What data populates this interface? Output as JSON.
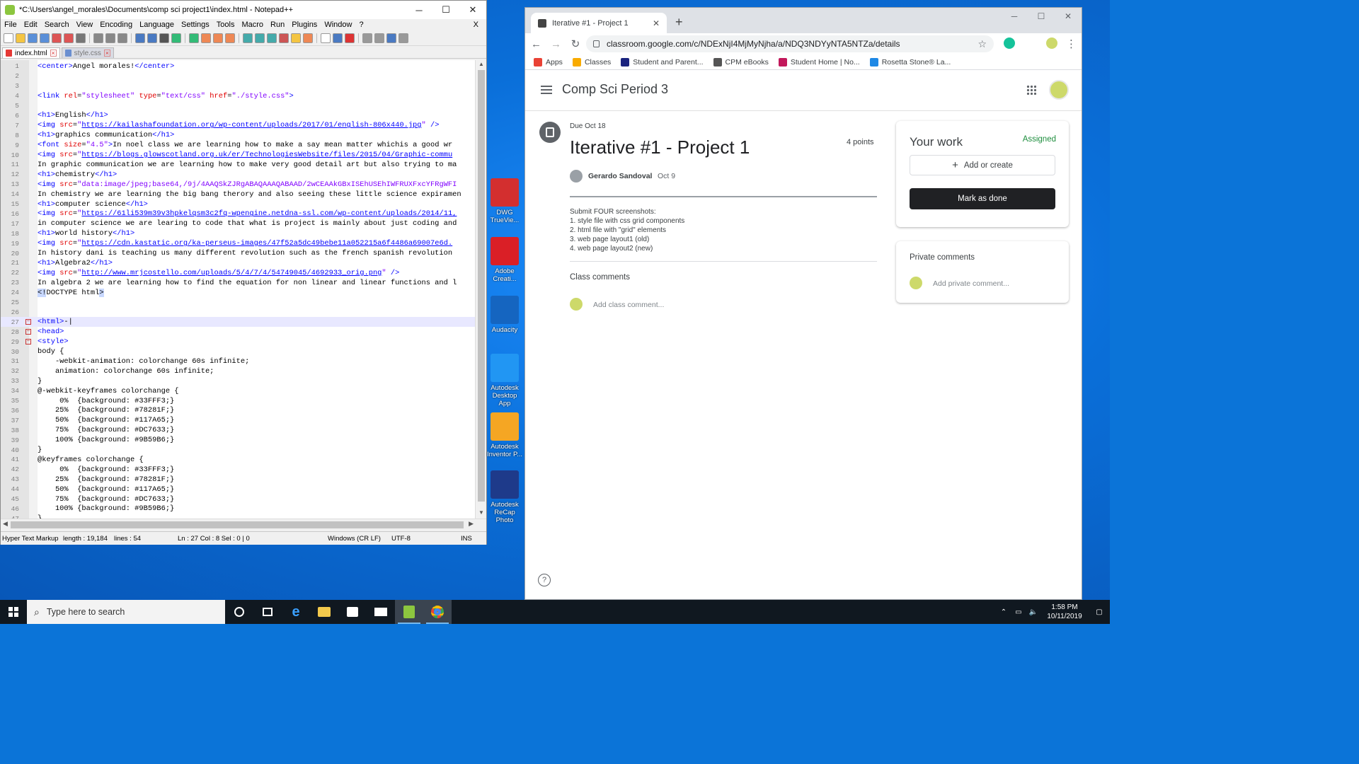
{
  "notepad": {
    "title": "*C:\\Users\\angel_morales\\Documents\\comp sci project1\\index.html - Notepad++",
    "menu": [
      "File",
      "Edit",
      "Search",
      "View",
      "Encoding",
      "Language",
      "Settings",
      "Tools",
      "Macro",
      "Run",
      "Plugins",
      "Window",
      "?"
    ],
    "menu_close": "X",
    "tabs": [
      "index.html",
      "style.css"
    ],
    "lines": [
      {
        "n": "1",
        "parts": [
          [
            "tag",
            "<center>"
          ],
          [
            "plain",
            "Angel morales!"
          ],
          [
            "tag",
            "</center>"
          ]
        ]
      },
      {
        "n": "2",
        "parts": []
      },
      {
        "n": "3",
        "parts": []
      },
      {
        "n": "4",
        "parts": [
          [
            "tag",
            "<link "
          ],
          [
            "attr",
            "rel"
          ],
          [
            "plain",
            "="
          ],
          [
            "val",
            "\"stylesheet\""
          ],
          [
            "plain",
            " "
          ],
          [
            "attr",
            "type"
          ],
          [
            "plain",
            "="
          ],
          [
            "val",
            "\"text/css\""
          ],
          [
            "plain",
            " "
          ],
          [
            "attr",
            "href"
          ],
          [
            "plain",
            "="
          ],
          [
            "val",
            "\"./style.css\""
          ],
          [
            "tag",
            ">"
          ]
        ]
      },
      {
        "n": "5",
        "parts": []
      },
      {
        "n": "6",
        "parts": [
          [
            "tag",
            "<h1>"
          ],
          [
            "plain",
            "English"
          ],
          [
            "tag",
            "</h1>"
          ]
        ]
      },
      {
        "n": "7",
        "parts": [
          [
            "tag",
            "<img "
          ],
          [
            "attr",
            "src"
          ],
          [
            "plain",
            "="
          ],
          [
            "val",
            "\""
          ],
          [
            "url",
            "https://kailashafoundation.org/wp-content/uploads/2017/01/english-806x440.jpg"
          ],
          [
            "val",
            "\""
          ],
          [
            "tag",
            " />"
          ]
        ]
      },
      {
        "n": "8",
        "parts": [
          [
            "tag",
            "<h1>"
          ],
          [
            "plain",
            "graphics communication"
          ],
          [
            "tag",
            "</h1>"
          ]
        ]
      },
      {
        "n": "9",
        "parts": [
          [
            "tag",
            "<font "
          ],
          [
            "attr",
            "size"
          ],
          [
            "plain",
            "="
          ],
          [
            "val",
            "\"4.5\""
          ],
          [
            "tag",
            ">"
          ],
          [
            "plain",
            "In noel class we are learning how to make a say mean matter whichis a good wr"
          ]
        ]
      },
      {
        "n": "10",
        "parts": [
          [
            "tag",
            "<img "
          ],
          [
            "attr",
            "src"
          ],
          [
            "plain",
            "="
          ],
          [
            "val",
            "\""
          ],
          [
            "url",
            "https://blogs.glowscotland.org.uk/er/TechnologiesWebsite/files/2015/04/Graphic-commu"
          ]
        ]
      },
      {
        "n": "11",
        "parts": [
          [
            "plain",
            "In graphic communication we are learning how to make very good detail art but also trying to ma"
          ]
        ]
      },
      {
        "n": "12",
        "parts": [
          [
            "tag",
            "<h1>"
          ],
          [
            "plain",
            "chemistry"
          ],
          [
            "tag",
            "</h1>"
          ]
        ]
      },
      {
        "n": "13",
        "parts": [
          [
            "tag",
            "<img "
          ],
          [
            "attr",
            "src"
          ],
          [
            "plain",
            "="
          ],
          [
            "val",
            "\"data:image/jpeg;base64,/9j/4AAQSkZJRgABAQAAAQABAAD/2wCEAAkGBxISEhUSEhIWFRUXFxcYFRgWFI"
          ]
        ]
      },
      {
        "n": "14",
        "parts": [
          [
            "plain",
            "In chemistry we are learning the big bang therory and also seeing these little science expiramen"
          ]
        ]
      },
      {
        "n": "15",
        "parts": [
          [
            "tag",
            "<h1>"
          ],
          [
            "plain",
            "computer science"
          ],
          [
            "tag",
            "</h1>"
          ]
        ]
      },
      {
        "n": "16",
        "parts": [
          [
            "tag",
            "<img "
          ],
          [
            "attr",
            "src"
          ],
          [
            "plain",
            "="
          ],
          [
            "val",
            "\""
          ],
          [
            "url",
            "https://61li539m39v3hpkelqsm3c2fq-wpengine.netdna-ssl.com/wp-content/uploads/2014/11,"
          ]
        ]
      },
      {
        "n": "17",
        "parts": [
          [
            "plain",
            "in computer science we are learing to code that what is project is mainly about just coding and"
          ]
        ]
      },
      {
        "n": "18",
        "parts": [
          [
            "tag",
            "<h1>"
          ],
          [
            "plain",
            "world history"
          ],
          [
            "tag",
            "</h1>"
          ]
        ]
      },
      {
        "n": "19",
        "parts": [
          [
            "tag",
            "<img "
          ],
          [
            "attr",
            "src"
          ],
          [
            "plain",
            "="
          ],
          [
            "val",
            "\""
          ],
          [
            "url",
            "https://cdn.kastatic.org/ka-perseus-images/47f52a5dc49bebe11a052215a6f4486a69007e6d."
          ]
        ]
      },
      {
        "n": "20",
        "parts": [
          [
            "plain",
            "In history dani is teaching us many different revolution such as the french spanish revolution"
          ]
        ]
      },
      {
        "n": "21",
        "parts": [
          [
            "tag",
            "<h1>"
          ],
          [
            "plain",
            "Algebra2"
          ],
          [
            "tag",
            "</h1>"
          ]
        ]
      },
      {
        "n": "22",
        "parts": [
          [
            "tag",
            "<img "
          ],
          [
            "attr",
            "src"
          ],
          [
            "plain",
            "="
          ],
          [
            "val",
            "\""
          ],
          [
            "url",
            "http://www.mrjcostello.com/uploads/5/4/7/4/54749045/4692933_orig.png"
          ],
          [
            "val",
            "\""
          ],
          [
            "tag",
            " />"
          ]
        ]
      },
      {
        "n": "23",
        "parts": [
          [
            "plain",
            "In algebra 2 we are learning how to find the equation for non linear and linear functions and l"
          ]
        ]
      },
      {
        "n": "24",
        "parts": [
          [
            "bracehl",
            "<!"
          ],
          [
            "plain",
            "DOCTYPE html"
          ],
          [
            "bracehl",
            ">"
          ]
        ]
      },
      {
        "n": "25",
        "parts": []
      },
      {
        "n": "26",
        "parts": []
      },
      {
        "n": "27",
        "fold": "−",
        "current": true,
        "parts": [
          [
            "tag",
            "<html>"
          ],
          [
            "plain",
            "-|"
          ]
        ]
      },
      {
        "n": "28",
        "fold": "−",
        "parts": [
          [
            "tag",
            "<head>"
          ]
        ]
      },
      {
        "n": "29",
        "fold": "−",
        "parts": [
          [
            "tag",
            "<style>"
          ]
        ]
      },
      {
        "n": "30",
        "parts": [
          [
            "plain",
            "body {"
          ]
        ]
      },
      {
        "n": "31",
        "parts": [
          [
            "plain",
            "    -webkit-animation: colorchange 60s infinite;"
          ]
        ]
      },
      {
        "n": "32",
        "parts": [
          [
            "plain",
            "    animation: colorchange 60s infinite;"
          ]
        ]
      },
      {
        "n": "33",
        "parts": [
          [
            "plain",
            "}"
          ]
        ]
      },
      {
        "n": "34",
        "parts": [
          [
            "plain",
            "@-webkit-keyframes colorchange {"
          ]
        ]
      },
      {
        "n": "35",
        "parts": [
          [
            "plain",
            "     0%  {background: #33FFF3;}"
          ]
        ]
      },
      {
        "n": "36",
        "parts": [
          [
            "plain",
            "    25%  {background: #78281F;}"
          ]
        ]
      },
      {
        "n": "37",
        "parts": [
          [
            "plain",
            "    50%  {background: #117A65;}"
          ]
        ]
      },
      {
        "n": "38",
        "parts": [
          [
            "plain",
            "    75%  {background: #DC7633;}"
          ]
        ]
      },
      {
        "n": "39",
        "parts": [
          [
            "plain",
            "    100% {background: #9B59B6;}"
          ]
        ]
      },
      {
        "n": "40",
        "parts": [
          [
            "plain",
            "}"
          ]
        ]
      },
      {
        "n": "41",
        "parts": [
          [
            "plain",
            "@keyframes colorchange {"
          ]
        ]
      },
      {
        "n": "42",
        "parts": [
          [
            "plain",
            "     0%  {background: #33FFF3;}"
          ]
        ]
      },
      {
        "n": "43",
        "parts": [
          [
            "plain",
            "    25%  {background: #78281F;}"
          ]
        ]
      },
      {
        "n": "44",
        "parts": [
          [
            "plain",
            "    50%  {background: #117A65;}"
          ]
        ]
      },
      {
        "n": "45",
        "parts": [
          [
            "plain",
            "    75%  {background: #DC7633;}"
          ]
        ]
      },
      {
        "n": "46",
        "parts": [
          [
            "plain",
            "    100% {background: #9B59B6;}"
          ]
        ]
      },
      {
        "n": "47",
        "parts": [
          [
            "plain",
            "}"
          ]
        ]
      }
    ],
    "status": {
      "lang": "Hyper Text Markup",
      "length": "length : 19,184",
      "lines": "lines : 54",
      "pos": "Ln : 27    Col : 8    Sel : 0 | 0",
      "eol": "Windows (CR LF)",
      "enc": "UTF-8",
      "mode": "INS"
    }
  },
  "desktop_icons": [
    {
      "label": "DWG TrueVie...",
      "color": "#d32f2f"
    },
    {
      "label": "Adobe Creati...",
      "color": "#da1f26"
    },
    {
      "label": "Audacity",
      "color": "#1565c0"
    },
    {
      "label": "Autodesk Desktop App",
      "color": "#2196f3"
    },
    {
      "label": "Autodesk Inventor P...",
      "color": "#f5a623"
    },
    {
      "label": "Autodesk ReCap Photo",
      "color": "#1e3a8a"
    }
  ],
  "chrome": {
    "tab_title": "Iterative #1 - Project 1",
    "url": "classroom.google.com/c/NDExNjI4MjMyNjha/a/NDQ3NDYyNTA5NTZa/details",
    "bookmarks": [
      {
        "label": "Apps",
        "color": "#e94235"
      },
      {
        "label": "Classes",
        "color": "#f9ab00"
      },
      {
        "label": "Student and Parent...",
        "color": "#1a237e"
      },
      {
        "label": "CPM eBooks",
        "color": "#555555"
      },
      {
        "label": "Student Home | No...",
        "color": "#c2185b"
      },
      {
        "label": "Rosetta Stone® La...",
        "color": "#1e88e5"
      }
    ]
  },
  "classroom": {
    "class_name": "Comp Sci Period 3",
    "due": "Due Oct 18",
    "title": "Iterative #1 - Project 1",
    "points": "4 points",
    "teacher": "Gerardo Sandoval",
    "posted": "Oct 9",
    "instructions": [
      "Submit FOUR screenshots:",
      "1. style file with css grid components",
      "2. html file with \"grid\" elements",
      "3. web page layout1 (old)",
      "4. web page layout2 (new)"
    ],
    "class_comments": "Class comments",
    "class_comment_placeholder": "Add class comment...",
    "your_work": "Your work",
    "status": "Assigned",
    "add_create": "Add or create",
    "mark_done": "Mark as done",
    "private_comments": "Private comments",
    "private_placeholder": "Add private comment..."
  },
  "taskbar": {
    "search_placeholder": "Type here to search",
    "time": "1:58 PM",
    "date": "10/11/2019"
  }
}
